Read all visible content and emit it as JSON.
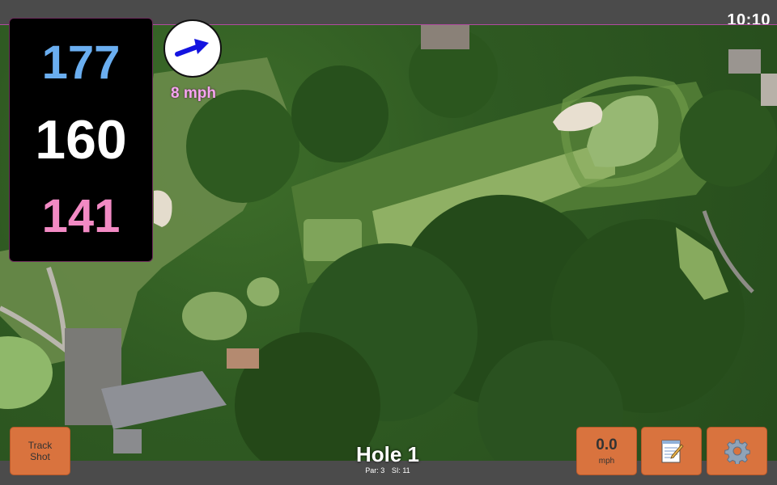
{
  "status_bar": {
    "time": "10:10"
  },
  "distances": {
    "back": "177",
    "middle": "160",
    "front": "141"
  },
  "wind": {
    "speed_label": "8 mph",
    "icon": "wind-arrow-icon"
  },
  "hole": {
    "title": "Hole 1",
    "par": "Par: 3",
    "stroke_index": "SI: 11"
  },
  "buttons": {
    "track_shot": "Track Shot",
    "speed_value": "0.0",
    "speed_unit": "mph",
    "notes_icon": "notepad-icon",
    "settings_icon": "gear-icon"
  },
  "colors": {
    "back_distance": "#6aaef0",
    "middle_distance": "#ffffff",
    "front_distance": "#f28ac4",
    "button": "#d9733e",
    "wind_label": "#f6a5f0"
  }
}
